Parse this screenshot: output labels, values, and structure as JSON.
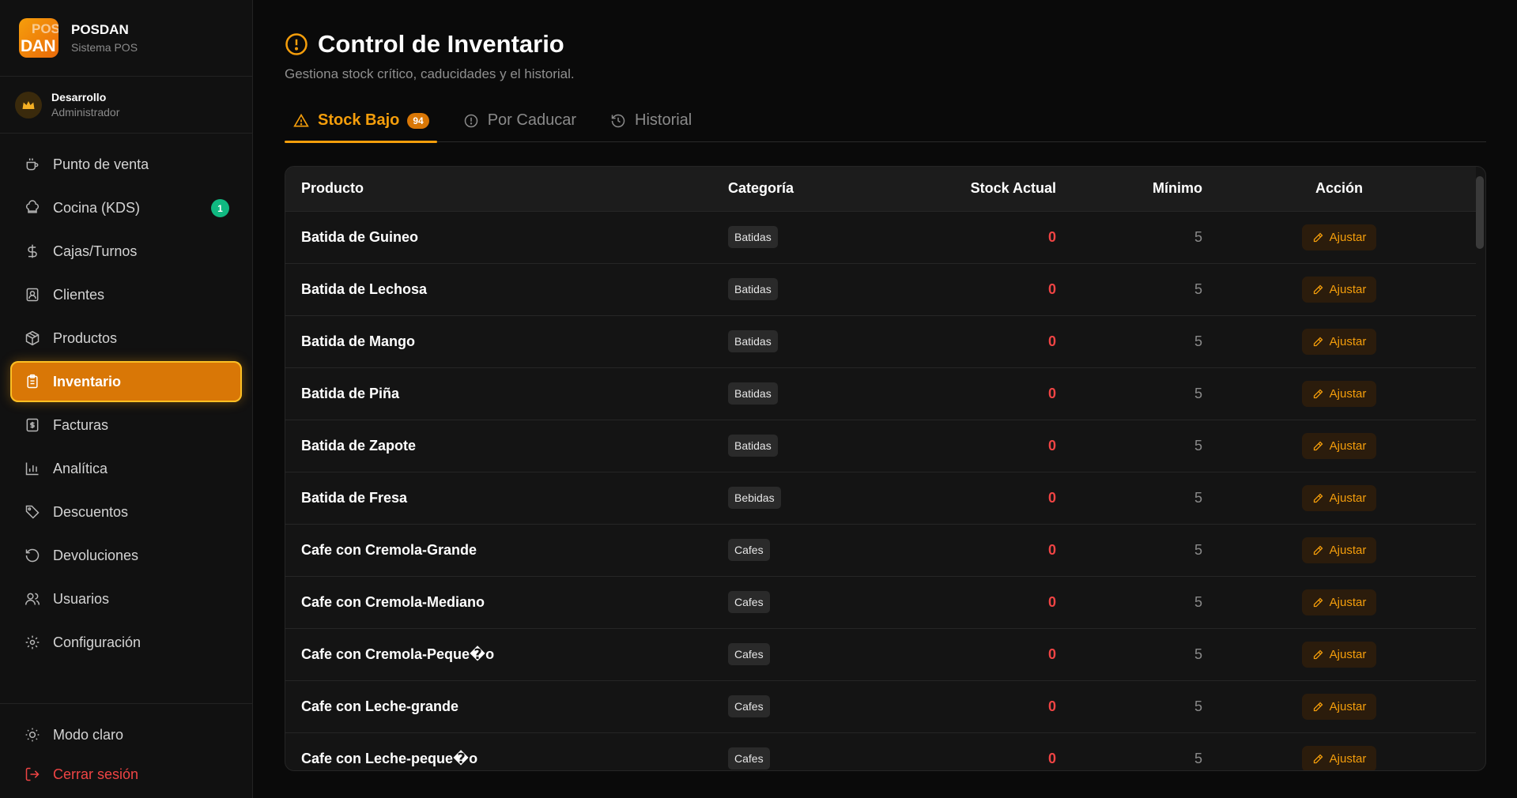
{
  "brand": {
    "logo_line1": "POS",
    "logo_line2": "DAN",
    "name": "POSDAN",
    "subtitle": "Sistema POS"
  },
  "user": {
    "avatar_icon": "crown-icon",
    "name": "Desarrollo",
    "role": "Administrador"
  },
  "sidebar": {
    "items": [
      {
        "label": "Punto de venta",
        "icon": "cup-icon"
      },
      {
        "label": "Cocina (KDS)",
        "icon": "chef-hat-icon",
        "badge": "1"
      },
      {
        "label": "Cajas/Turnos",
        "icon": "dollar-icon"
      },
      {
        "label": "Clientes",
        "icon": "contact-icon"
      },
      {
        "label": "Productos",
        "icon": "package-icon"
      },
      {
        "label": "Inventario",
        "icon": "clipboard-icon",
        "active": true
      },
      {
        "label": "Facturas",
        "icon": "receipt-icon"
      },
      {
        "label": "Analítica",
        "icon": "bar-chart-icon"
      },
      {
        "label": "Descuentos",
        "icon": "tag-icon"
      },
      {
        "label": "Devoluciones",
        "icon": "undo-icon"
      },
      {
        "label": "Usuarios",
        "icon": "users-icon"
      },
      {
        "label": "Configuración",
        "icon": "gear-icon"
      }
    ],
    "bottom": {
      "theme_label": "Modo claro",
      "logout_label": "Cerrar sesión"
    }
  },
  "page": {
    "title": "Control de Inventario",
    "subtitle": "Gestiona stock crítico, caducidades y el historial."
  },
  "tabs": [
    {
      "label": "Stock Bajo",
      "count": "94",
      "active": true
    },
    {
      "label": "Por Caducar"
    },
    {
      "label": "Historial"
    }
  ],
  "table": {
    "headers": {
      "product": "Producto",
      "category": "Categoría",
      "stock": "Stock Actual",
      "min": "Mínimo",
      "action": "Acción"
    },
    "action_label": "Ajustar",
    "rows": [
      {
        "product": "Batida de Guineo",
        "category": "Batidas",
        "stock": "0",
        "min": "5"
      },
      {
        "product": "Batida de Lechosa",
        "category": "Batidas",
        "stock": "0",
        "min": "5"
      },
      {
        "product": "Batida de Mango",
        "category": "Batidas",
        "stock": "0",
        "min": "5"
      },
      {
        "product": "Batida de Piña",
        "category": "Batidas",
        "stock": "0",
        "min": "5"
      },
      {
        "product": "Batida de Zapote",
        "category": "Batidas",
        "stock": "0",
        "min": "5"
      },
      {
        "product": "Batida de Fresa",
        "category": "Bebidas",
        "stock": "0",
        "min": "5"
      },
      {
        "product": "Cafe con Cremola-Grande",
        "category": "Cafes",
        "stock": "0",
        "min": "5"
      },
      {
        "product": "Cafe con Cremola-Mediano",
        "category": "Cafes",
        "stock": "0",
        "min": "5"
      },
      {
        "product": "Cafe con Cremola-Peque�o",
        "category": "Cafes",
        "stock": "0",
        "min": "5"
      },
      {
        "product": "Cafe con Leche-grande",
        "category": "Cafes",
        "stock": "0",
        "min": "5"
      },
      {
        "product": "Cafe con Leche-peque�o",
        "category": "Cafes",
        "stock": "0",
        "min": "5"
      }
    ]
  },
  "colors": {
    "accent": "#f59e0b",
    "active_nav": "#d97706",
    "danger": "#ef4444",
    "badge": "#10b981"
  }
}
